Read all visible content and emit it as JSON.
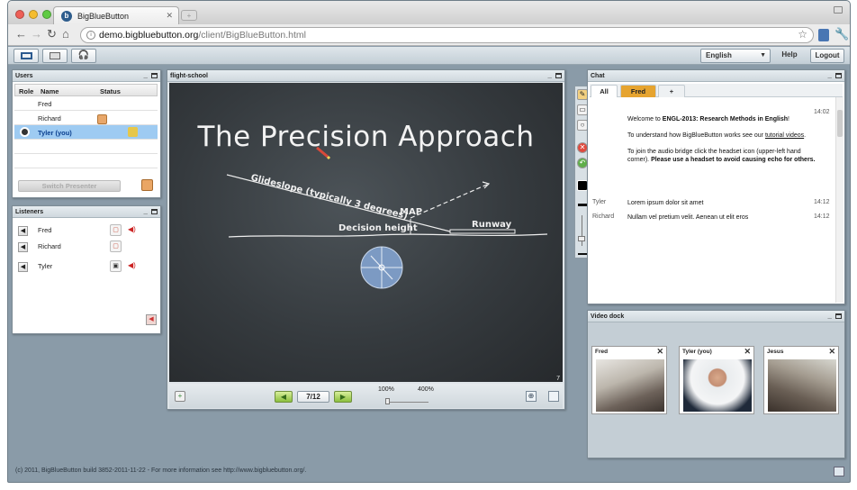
{
  "browser": {
    "tab_title": "BigBlueButton",
    "tab_favicon": "b",
    "tab_close": "✕",
    "url_host": "demo.bigbluebutton.org",
    "url_path": "/client/BigBlueButton.html",
    "lights": [
      "#ee5f57",
      "#f5bd2f",
      "#5fcb43"
    ]
  },
  "appbar": {
    "language": "English",
    "help": "Help",
    "logout": "Logout"
  },
  "users": {
    "title": "Users",
    "columns": [
      "Role",
      "Name",
      "Status"
    ],
    "rows": [
      {
        "name": "Fred"
      },
      {
        "name": "Richard"
      },
      {
        "name": "Tyler (you)"
      }
    ],
    "switch_presenter": "Switch Presenter"
  },
  "listeners": {
    "title": "Listeners",
    "rows": [
      {
        "name": "Fred"
      },
      {
        "name": "Richard"
      },
      {
        "name": "Tyler"
      }
    ]
  },
  "presentation": {
    "title": "flight-school",
    "slide_title": "The Precision Approach",
    "labels": {
      "glideslope": "Glideslope (typically 3 degrees)",
      "map": "MAP",
      "decision_height": "Decision height",
      "runway": "Runway"
    },
    "slide_number_corner": "7",
    "page_label": "7/12",
    "zoom_min": "100%",
    "zoom_max": "400%",
    "zoom_level": 0.0
  },
  "chat": {
    "title": "Chat",
    "tabs": [
      "All",
      "Fred",
      "+"
    ],
    "welcome": {
      "time": "14:02",
      "line1_prefix": "Welcome to ",
      "line1_bold": "ENGL-2013: Research Methods in English",
      "line1_suffix": "!",
      "line2_prefix": "To understand how BigBlueButton works see our ",
      "line2_link": "tutorial videos",
      "line2_suffix": ".",
      "line3_prefix": "To join the audio bridge click the headset icon (upper-left hand corner). ",
      "line3_bold": "Please use a headset to avoid causing echo for others."
    },
    "messages": [
      {
        "who": "Tyler",
        "text": "Lorem ipsum dolor sit amet",
        "time": "14:12"
      },
      {
        "who": "Richard",
        "text": "Nullam vel pretium velit. Aenean ut elit eros",
        "time": "14:12"
      }
    ]
  },
  "videodock": {
    "title": "Video dock",
    "tiles": [
      {
        "name": "Fred"
      },
      {
        "name": "Tyler (you)"
      },
      {
        "name": "Jesus"
      }
    ]
  },
  "footer": "(c) 2011, BigBlueButton build 3852-2011-11-22 - For more information see http://www.bigbluebutton.org/."
}
